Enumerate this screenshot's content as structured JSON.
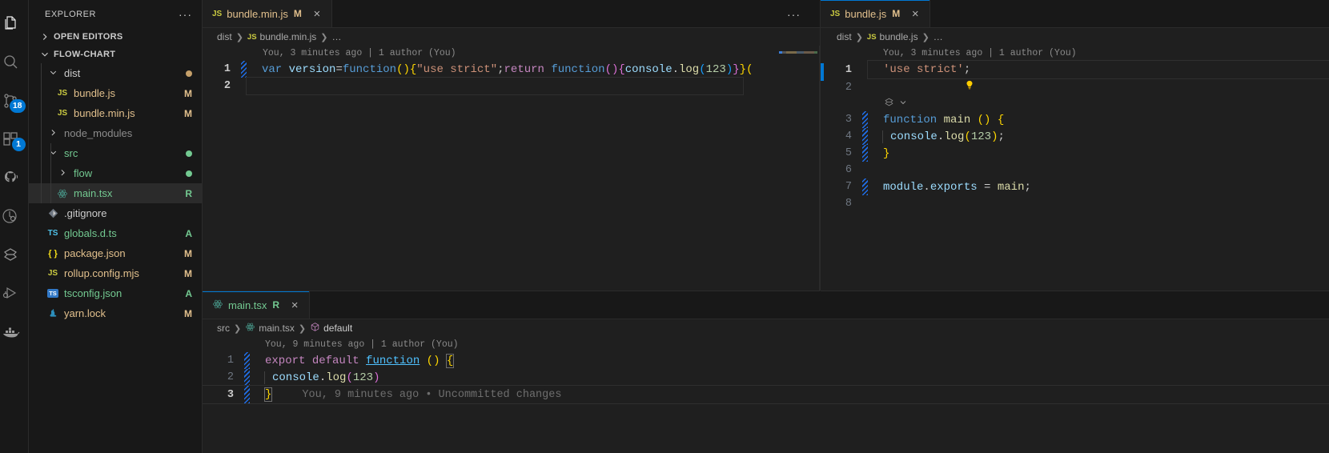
{
  "app": {
    "theme_bg": "#1f1f1f",
    "accent": "#0078d4"
  },
  "activitybar": {
    "items": [
      {
        "name": "explorer",
        "icon": "files-icon",
        "badge": null
      },
      {
        "name": "search",
        "icon": "search-icon",
        "badge": null
      },
      {
        "name": "source-control",
        "icon": "source-control-icon",
        "badge": "18"
      },
      {
        "name": "extensions",
        "icon": "extensions-icon",
        "badge": "1"
      },
      {
        "name": "github",
        "icon": "github-cat-icon",
        "badge": null
      },
      {
        "name": "testing",
        "icon": "beaker-testing-icon",
        "badge": null
      },
      {
        "name": "jest",
        "icon": "jest-icon",
        "badge": null
      },
      {
        "name": "run-and-debug",
        "icon": "run-debug-icon",
        "badge": null
      },
      {
        "name": "docker",
        "icon": "docker-icon",
        "badge": null
      }
    ]
  },
  "sidebar": {
    "title": "EXPLORER",
    "more_actions": "···",
    "sections": [
      {
        "label": "OPEN EDITORS",
        "expanded": false
      },
      {
        "label": "FLOW-CHART",
        "expanded": true
      }
    ],
    "tree": [
      {
        "label": "dist",
        "icon": "folder-open-icon",
        "depth": 1,
        "kind": "folder",
        "expanded": true,
        "status": "",
        "dot": "#c5a06a",
        "selected": false
      },
      {
        "label": "bundle.js",
        "icon": "js-file-icon",
        "depth": 2,
        "kind": "file",
        "status": "M",
        "status_color": "#e2c08d",
        "name_color": "#e2c08d",
        "selected": false
      },
      {
        "label": "bundle.min.js",
        "icon": "js-file-icon",
        "depth": 2,
        "kind": "file",
        "status": "M",
        "status_color": "#e2c08d",
        "name_color": "#e2c08d",
        "selected": false
      },
      {
        "label": "node_modules",
        "icon": "folder-icon",
        "depth": 1,
        "kind": "folder",
        "expanded": false,
        "status": "",
        "name_color": "#8c8c8c",
        "selected": false
      },
      {
        "label": "src",
        "icon": "folder-open-icon",
        "depth": 1,
        "kind": "folder",
        "expanded": true,
        "status": "",
        "dot": "#73c991",
        "name_color": "#73c991",
        "selected": false
      },
      {
        "label": "flow",
        "icon": "folder-icon",
        "depth": 2,
        "kind": "folder",
        "expanded": false,
        "status": "",
        "dot": "#73c991",
        "name_color": "#73c991",
        "selected": false
      },
      {
        "label": "main.tsx",
        "icon": "react-icon",
        "depth": 2,
        "kind": "file",
        "status": "R",
        "status_color": "#73c991",
        "name_color": "#73c991",
        "selected": true
      },
      {
        "label": ".gitignore",
        "icon": "git-icon",
        "depth": 1,
        "kind": "file",
        "status": "",
        "name_color": "#cccccc",
        "selected": false
      },
      {
        "label": "globals.d.ts",
        "icon": "ts-def-icon",
        "depth": 1,
        "kind": "file",
        "status": "A",
        "status_color": "#73c991",
        "name_color": "#73c991",
        "selected": false
      },
      {
        "label": "package.json",
        "icon": "json-icon",
        "depth": 1,
        "kind": "file",
        "status": "M",
        "status_color": "#e2c08d",
        "name_color": "#e2c08d",
        "selected": false
      },
      {
        "label": "rollup.config.mjs",
        "icon": "js-file-icon",
        "depth": 1,
        "kind": "file",
        "status": "M",
        "status_color": "#e2c08d",
        "name_color": "#e2c08d",
        "selected": false
      },
      {
        "label": "tsconfig.json",
        "icon": "tsconfig-icon",
        "depth": 1,
        "kind": "file",
        "status": "A",
        "status_color": "#73c991",
        "name_color": "#73c991",
        "selected": false
      },
      {
        "label": "yarn.lock",
        "icon": "yarn-icon",
        "depth": 1,
        "kind": "file",
        "status": "M",
        "status_color": "#e2c08d",
        "name_color": "#e2c08d",
        "selected": false
      }
    ]
  },
  "editors": {
    "bundle_min": {
      "tab": {
        "label": "bundle.min.js",
        "icon": "js-file-icon",
        "dirty_badge": "M",
        "close": "×"
      },
      "tab_actions": "···",
      "breadcrumbs": [
        "dist",
        "bundle.min.js",
        "…"
      ],
      "blame": "You, 3 minutes ago | 1 author (You)",
      "lines": [
        {
          "num": "1",
          "changed": true,
          "text": "var version=function(){\"use strict\";return function(){console.log(123)}}("
        },
        {
          "num": "2",
          "changed": false,
          "text": ""
        }
      ]
    },
    "bundle": {
      "tab": {
        "label": "bundle.js",
        "icon": "js-file-icon",
        "dirty_badge": "M",
        "close": "×"
      },
      "breadcrumbs": [
        "dist",
        "bundle.js",
        "…"
      ],
      "blame": "You, 3 minutes ago | 1 author (You)",
      "lightbulb": "lightbulb-quickfix-icon",
      "codelens": "jest-run-icon",
      "lines": [
        {
          "num": "1",
          "changed": false,
          "text": "'use strict';"
        },
        {
          "num": "2",
          "changed": false,
          "text": ""
        },
        {
          "num": "3",
          "changed": true,
          "text": "function main () {"
        },
        {
          "num": "4",
          "changed": true,
          "text": "  console.log(123);"
        },
        {
          "num": "5",
          "changed": true,
          "text": "}"
        },
        {
          "num": "6",
          "changed": false,
          "text": ""
        },
        {
          "num": "7",
          "changed": true,
          "text": "module.exports = main;"
        },
        {
          "num": "8",
          "changed": false,
          "text": ""
        }
      ]
    },
    "main_tsx": {
      "tab": {
        "label": "main.tsx",
        "icon": "react-icon",
        "dirty_badge": "R",
        "close": "×"
      },
      "breadcrumbs": [
        "src",
        "main.tsx",
        "default"
      ],
      "blame": "You, 9 minutes ago | 1 author (You)",
      "inline_blame": "You, 9 minutes ago • Uncommitted changes",
      "lines": [
        {
          "num": "1",
          "changed": true,
          "text": "export default function () {"
        },
        {
          "num": "2",
          "changed": true,
          "text": "  console.log(123)"
        },
        {
          "num": "3",
          "changed": true,
          "text": "}"
        }
      ]
    }
  }
}
